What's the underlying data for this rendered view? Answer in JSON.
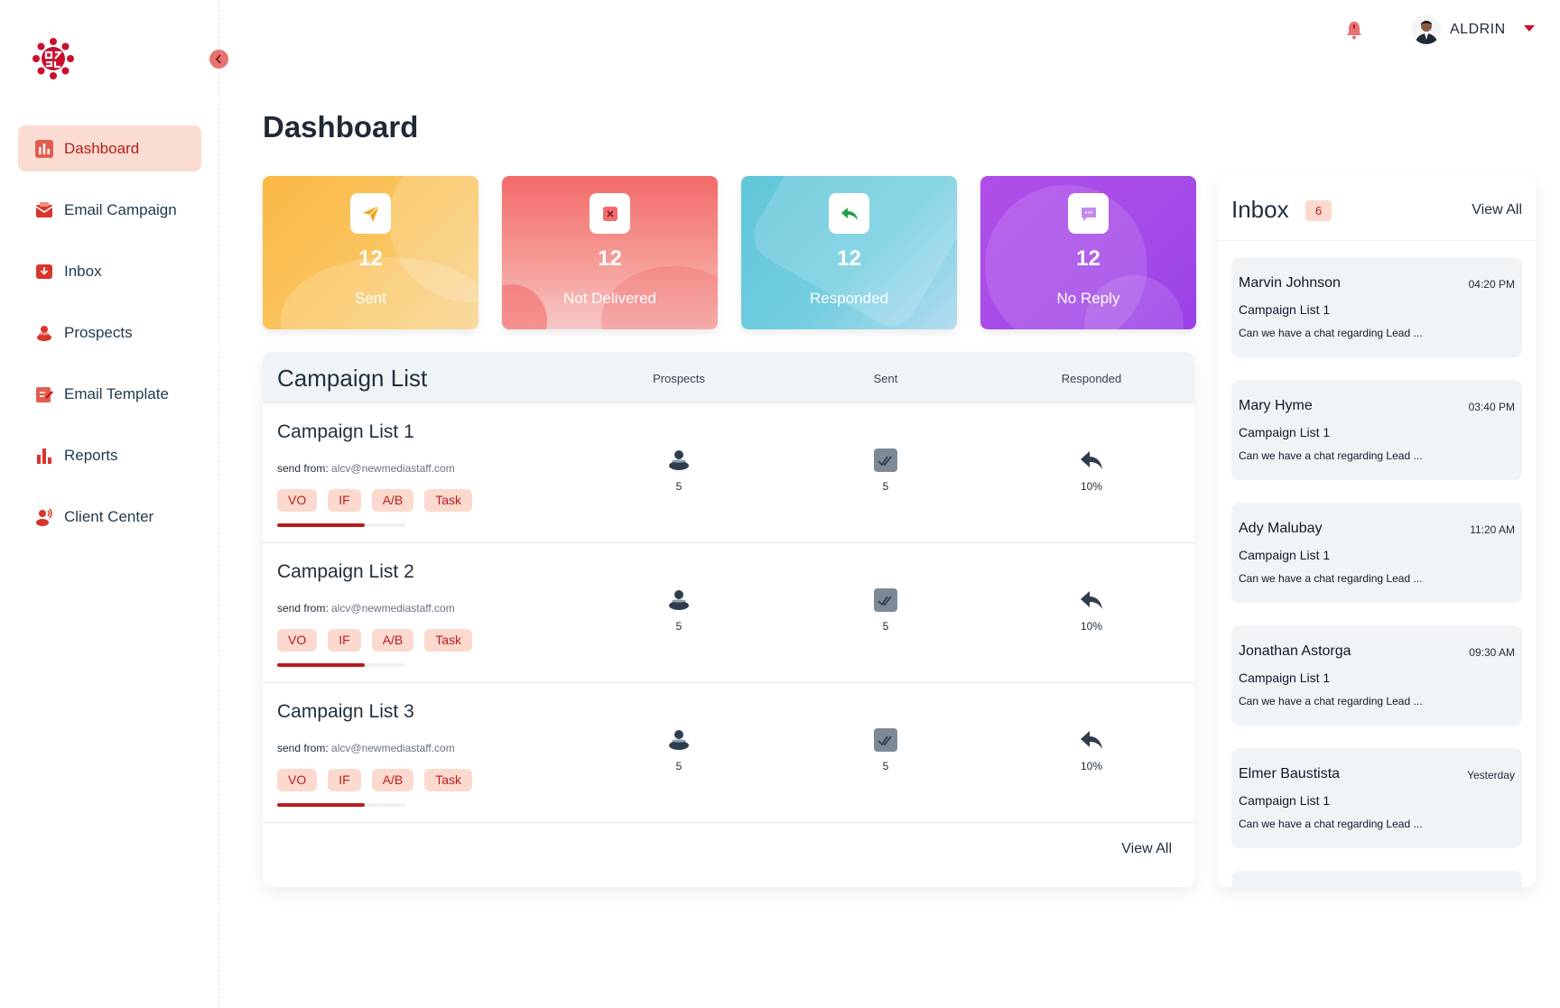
{
  "sidebar": {
    "items": [
      {
        "label": "Dashboard",
        "icon": "chart-bars-icon",
        "active": true
      },
      {
        "label": "Email Campaign",
        "icon": "email-campaign-icon"
      },
      {
        "label": "Inbox",
        "icon": "inbox-icon"
      },
      {
        "label": "Prospects",
        "icon": "people-icon"
      },
      {
        "label": "Email Template",
        "icon": "edit-template-icon"
      },
      {
        "label": "Reports",
        "icon": "bar-chart-icon"
      },
      {
        "label": "Client Center",
        "icon": "client-support-icon"
      }
    ]
  },
  "header": {
    "user_name": "ALDRIN"
  },
  "page": {
    "title": "Dashboard"
  },
  "stats": [
    {
      "value": "12",
      "label": "Sent",
      "icon": "send-icon",
      "color": "#fbb845"
    },
    {
      "value": "12",
      "label": "Not Delivered",
      "icon": "close-icon",
      "color": "#f47a7a"
    },
    {
      "value": "12",
      "label": "Responded",
      "icon": "reply-icon",
      "color": "#5fc6d8"
    },
    {
      "value": "12",
      "label": "No Reply",
      "icon": "chat-icon",
      "color": "#a64ce8"
    }
  ],
  "campaigns": {
    "title": "Campaign List",
    "columns": [
      "Prospects",
      "Sent",
      "Responded"
    ],
    "from_label": "send from:",
    "view_all": "View All",
    "rows": [
      {
        "name": "Campaign List 1",
        "email": "alcv@newmediastaff.com",
        "chips": [
          "VO",
          "IF",
          "A/B",
          "Task"
        ],
        "prospects": "5",
        "sent": "5",
        "responded": "10%",
        "progress": 0.68
      },
      {
        "name": "Campaign List 2",
        "email": "alcv@newmediastaff.com",
        "chips": [
          "VO",
          "IF",
          "A/B",
          "Task"
        ],
        "prospects": "5",
        "sent": "5",
        "responded": "10%",
        "progress": 0.68
      },
      {
        "name": "Campaign List 3",
        "email": "alcv@newmediastaff.com",
        "chips": [
          "VO",
          "IF",
          "A/B",
          "Task"
        ],
        "prospects": "5",
        "sent": "5",
        "responded": "10%",
        "progress": 0.68
      }
    ]
  },
  "inbox": {
    "title": "Inbox",
    "count": "6",
    "view_all": "View All",
    "messages": [
      {
        "from": "Marvin Johnson",
        "time": "04:20 PM",
        "campaign": "Campaign List 1",
        "preview": "Can we have a chat regarding Lead ..."
      },
      {
        "from": "Mary Hyme",
        "time": "03:40 PM",
        "campaign": "Campaign List 1",
        "preview": "Can we have a chat regarding Lead ..."
      },
      {
        "from": "Ady Malubay",
        "time": "11:20 AM",
        "campaign": "Campaign List 1",
        "preview": "Can we have a chat regarding Lead ..."
      },
      {
        "from": "Jonathan Astorga",
        "time": "09:30 AM",
        "campaign": "Campaign List 1",
        "preview": "Can we have a chat regarding Lead ..."
      },
      {
        "from": "Elmer Baustista",
        "time": "Yesterday",
        "campaign": "Campaign List 1",
        "preview": "Can we have a chat regarding Lead ..."
      }
    ]
  },
  "colors": {
    "brand": "#b91c1c",
    "active_nav_bg": "#fbdcd2",
    "chip_bg": "#fcd9ce"
  }
}
